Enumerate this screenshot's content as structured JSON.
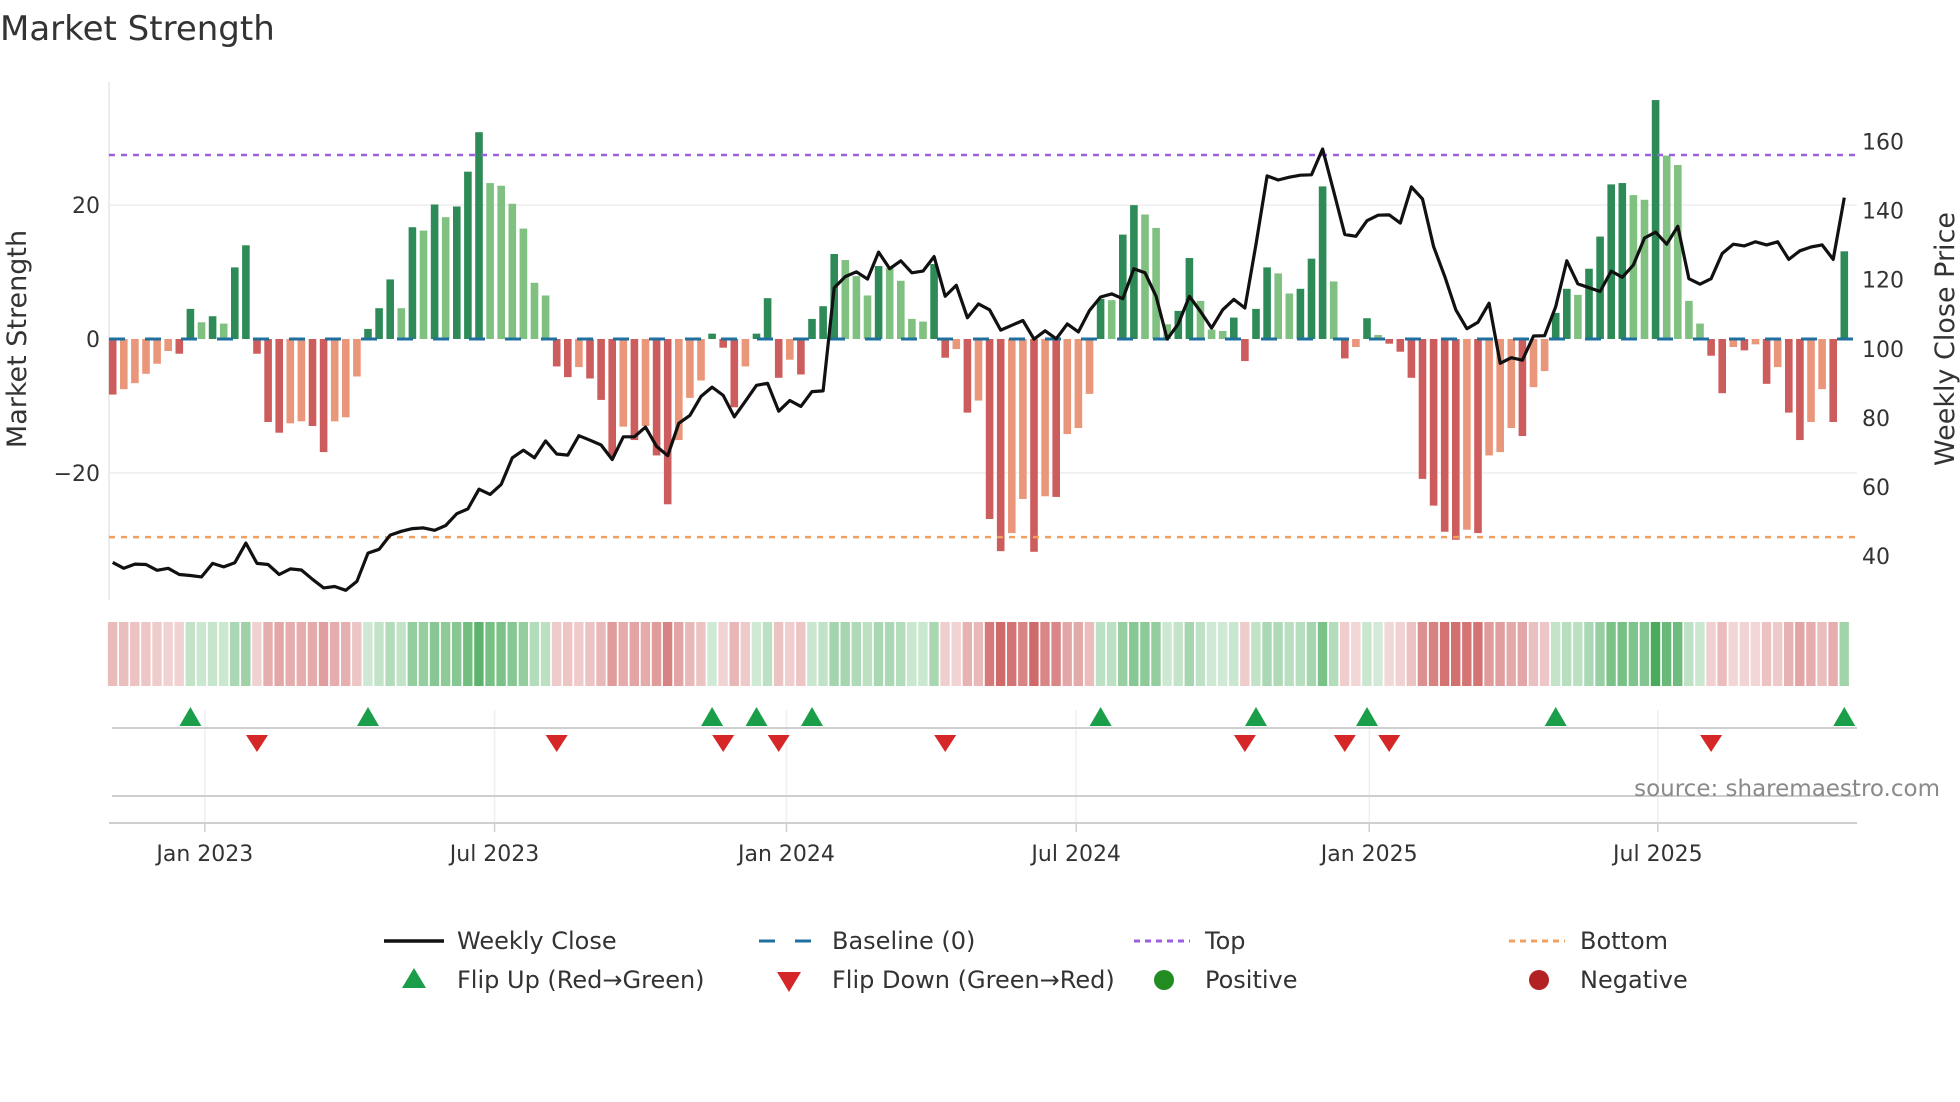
{
  "chart_data": {
    "type": "bar",
    "title": "Market Strength",
    "ylabel": "Market Strength",
    "y2label": "Weekly Close Price",
    "ylim": [
      -39,
      38.4
    ],
    "y2lim": [
      27.2,
      177.3
    ],
    "y_ticks": [
      {
        "label": "20",
        "value": 20
      },
      {
        "label": "0",
        "value": 0
      },
      {
        "label": "−20",
        "value": -20
      }
    ],
    "y2_ticks": [
      {
        "label": "160",
        "value": 160
      },
      {
        "label": "140",
        "value": 140
      },
      {
        "label": "120",
        "value": 120
      },
      {
        "label": "100",
        "value": 100
      },
      {
        "label": "80",
        "value": 80
      },
      {
        "label": "60",
        "value": 60
      },
      {
        "label": "40",
        "value": 40
      }
    ],
    "x_ticks": [
      {
        "label": "Jan 2023",
        "week": 8.3
      },
      {
        "label": "Jul 2023",
        "week": 34.4
      },
      {
        "label": "Jan 2024",
        "week": 60.7
      },
      {
        "label": "Jul 2024",
        "week": 86.8
      },
      {
        "label": "Jan 2025",
        "week": 113.2
      },
      {
        "label": "Jul 2025",
        "week": 139.2
      }
    ],
    "top_level": 27.5,
    "bottom_level": -29.6,
    "baseline": 0,
    "market_strength": [
      -8.3,
      -7.5,
      -6.6,
      -5.2,
      -3.7,
      -1.8,
      -2.2,
      4.5,
      2.5,
      3.4,
      2.3,
      10.7,
      14.0,
      -2.2,
      -12.4,
      -14.0,
      -12.6,
      -12.3,
      -13.0,
      -16.9,
      -12.3,
      -11.7,
      -5.6,
      1.5,
      4.6,
      8.9,
      4.6,
      16.7,
      16.2,
      20.1,
      18.2,
      19.8,
      25.0,
      30.9,
      23.3,
      22.9,
      20.2,
      16.5,
      8.4,
      6.5,
      -4.1,
      -5.7,
      -4.2,
      -5.9,
      -9.1,
      -17.5,
      -13.1,
      -15.1,
      -13.0,
      -17.4,
      -24.7,
      -15.1,
      -8.8,
      -6.2,
      0.8,
      -1.3,
      -10.2,
      -4.1,
      0.8,
      6.1,
      -5.8,
      -3.1,
      -5.3,
      3.0,
      4.9,
      12.7,
      11.8,
      9.4,
      6.5,
      10.9,
      10.6,
      8.7,
      3.0,
      2.6,
      11.2,
      -2.8,
      -1.5,
      -11.0,
      -9.2,
      -26.9,
      -31.7,
      -29.0,
      -23.9,
      -31.8,
      -23.5,
      -23.6,
      -14.2,
      -13.3,
      -8.2,
      6.0,
      5.8,
      15.6,
      20.0,
      18.6,
      16.6,
      2.2,
      4.2,
      12.1,
      5.7,
      1.4,
      1.2,
      3.2,
      -3.3,
      4.5,
      10.7,
      9.8,
      6.8,
      7.5,
      12.0,
      22.8,
      8.6,
      -2.9,
      -1.2,
      3.1,
      0.6,
      -0.7,
      -1.9,
      -5.8,
      -20.9,
      -24.9,
      -28.8,
      -30.0,
      -28.5,
      -29.0,
      -17.4,
      -16.9,
      -13.3,
      -14.5,
      -7.2,
      -4.8,
      3.9,
      7.5,
      6.6,
      10.5,
      15.3,
      23.1,
      23.3,
      21.5,
      20.8,
      35.7,
      27.4,
      26.0,
      5.7,
      2.3,
      -2.5,
      -8.1,
      -1.2,
      -1.7,
      -0.8,
      -6.7,
      -4.2,
      -11.0,
      -15.1,
      -12.4,
      -7.5,
      -12.4,
      13.1
    ],
    "weekly_close": [
      38.1,
      36.4,
      37.6,
      37.5,
      35.8,
      36.4,
      34.6,
      34.3,
      33.9,
      37.8,
      36.8,
      38.0,
      43.7,
      37.8,
      37.5,
      34.6,
      36.2,
      35.9,
      33.2,
      30.7,
      31.1,
      30.0,
      32.6,
      40.8,
      41.9,
      46.0,
      47.1,
      47.9,
      48.1,
      47.4,
      48.8,
      52.2,
      53.6,
      59.3,
      57.8,
      60.7,
      68.4,
      70.6,
      68.4,
      73.3,
      69.5,
      69.2,
      74.8,
      73.5,
      72.1,
      67.9,
      74.5,
      74.5,
      77.3,
      71.7,
      69.0,
      78.4,
      80.7,
      86.2,
      88.9,
      86.5,
      80.3,
      84.8,
      89.4,
      90.0,
      81.9,
      85.0,
      83.3,
      87.6,
      87.8,
      117.7,
      120.9,
      122.3,
      120.2,
      128.0,
      123.2,
      125.5,
      122.0,
      122.5,
      126.7,
      115.2,
      118.4,
      109.0,
      113.0,
      111.3,
      105.4,
      106.8,
      108.2,
      102.8,
      105.2,
      102.9,
      107.2,
      104.9,
      111.1,
      115.0,
      115.9,
      114.5,
      123.2,
      122.0,
      115.2,
      102.8,
      107.2,
      115.2,
      110.8,
      106.0,
      111.3,
      114.3,
      111.8,
      130.3,
      150.1,
      148.9,
      149.7,
      150.3,
      150.4,
      157.9,
      145.6,
      133.1,
      132.6,
      137.1,
      138.7,
      138.8,
      136.4,
      146.9,
      143.4,
      129.6,
      121.0,
      111.3,
      105.8,
      107.7,
      113.2,
      95.8,
      97.4,
      96.7,
      103.7,
      103.8,
      112.2,
      125.5,
      118.8,
      117.7,
      116.6,
      122.5,
      120.7,
      124.3,
      132.1,
      133.8,
      130.3,
      135.5,
      120.3,
      118.7,
      120.3,
      127.6,
      130.3,
      129.8,
      131.0,
      130.1,
      131.0,
      125.9,
      128.4,
      129.5,
      130.1,
      125.9,
      143.8
    ],
    "legend": {
      "placement": "bottom",
      "items": [
        {
          "label": "Weekly Close",
          "symbol": "line"
        },
        {
          "label": "Baseline (0)",
          "symbol": "dash"
        },
        {
          "label": "Top",
          "symbol": "dot-purple"
        },
        {
          "label": "Bottom",
          "symbol": "dot-orange"
        },
        {
          "label": "Flip Up (Red→Green)",
          "symbol": "triangle-up"
        },
        {
          "label": "Flip Down (Green→Red)",
          "symbol": "triangle-down"
        },
        {
          "label": "Positive",
          "symbol": "circle-green"
        },
        {
          "label": "Negative",
          "symbol": "circle-red"
        }
      ]
    },
    "source": "source: sharemaestro.com",
    "colors": {
      "pos_strong": "#2e8b57",
      "pos_weak": "#80c080",
      "neg_strong": "#cd5c5c",
      "neg_weak": "#e9967a",
      "line": "#111111",
      "baseline": "#1f6f9f",
      "top": "#9b5fe0",
      "bottom": "#f0a060",
      "flip_up": "#1a9e4a",
      "flip_down": "#d62728",
      "positive": "#228b22",
      "negative": "#b22222"
    }
  }
}
